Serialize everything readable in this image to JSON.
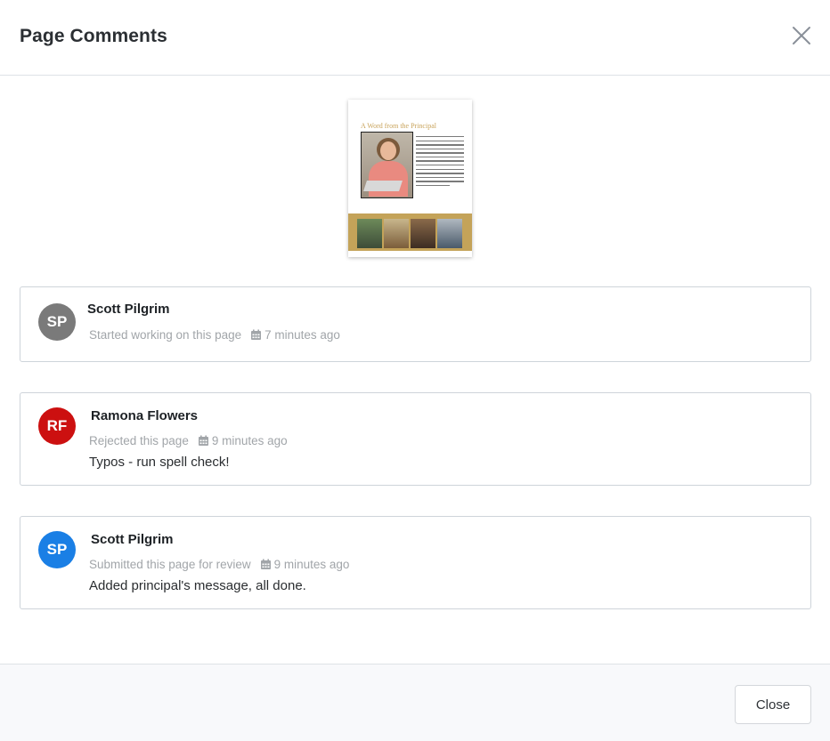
{
  "modal": {
    "title": "Page Comments",
    "close_button_label": "Close",
    "close_icon": "close-icon"
  },
  "thumbnail": {
    "heading": "A Word from the Principal"
  },
  "colors": {
    "avatar_gray": "#7a7a7a",
    "avatar_red": "#cc1010",
    "avatar_blue": "#1a7fe5",
    "meta_text": "#a1a5a9",
    "border": "#ced4da"
  },
  "comments": [
    {
      "initials": "SP",
      "author": "Scott Pilgrim",
      "action": "Started working on this page",
      "time": "7 minutes ago",
      "message": "",
      "avatar_color": "#7a7a7a"
    },
    {
      "initials": "RF",
      "author": "Ramona Flowers",
      "action": "Rejected this page",
      "time": "9 minutes ago",
      "message": "Typos - run spell check!",
      "avatar_color": "#cc1010"
    },
    {
      "initials": "SP",
      "author": "Scott Pilgrim",
      "action": "Submitted this page for review",
      "time": "9 minutes ago",
      "message": "Added principal's message, all done.",
      "avatar_color": "#1a7fe5"
    }
  ]
}
